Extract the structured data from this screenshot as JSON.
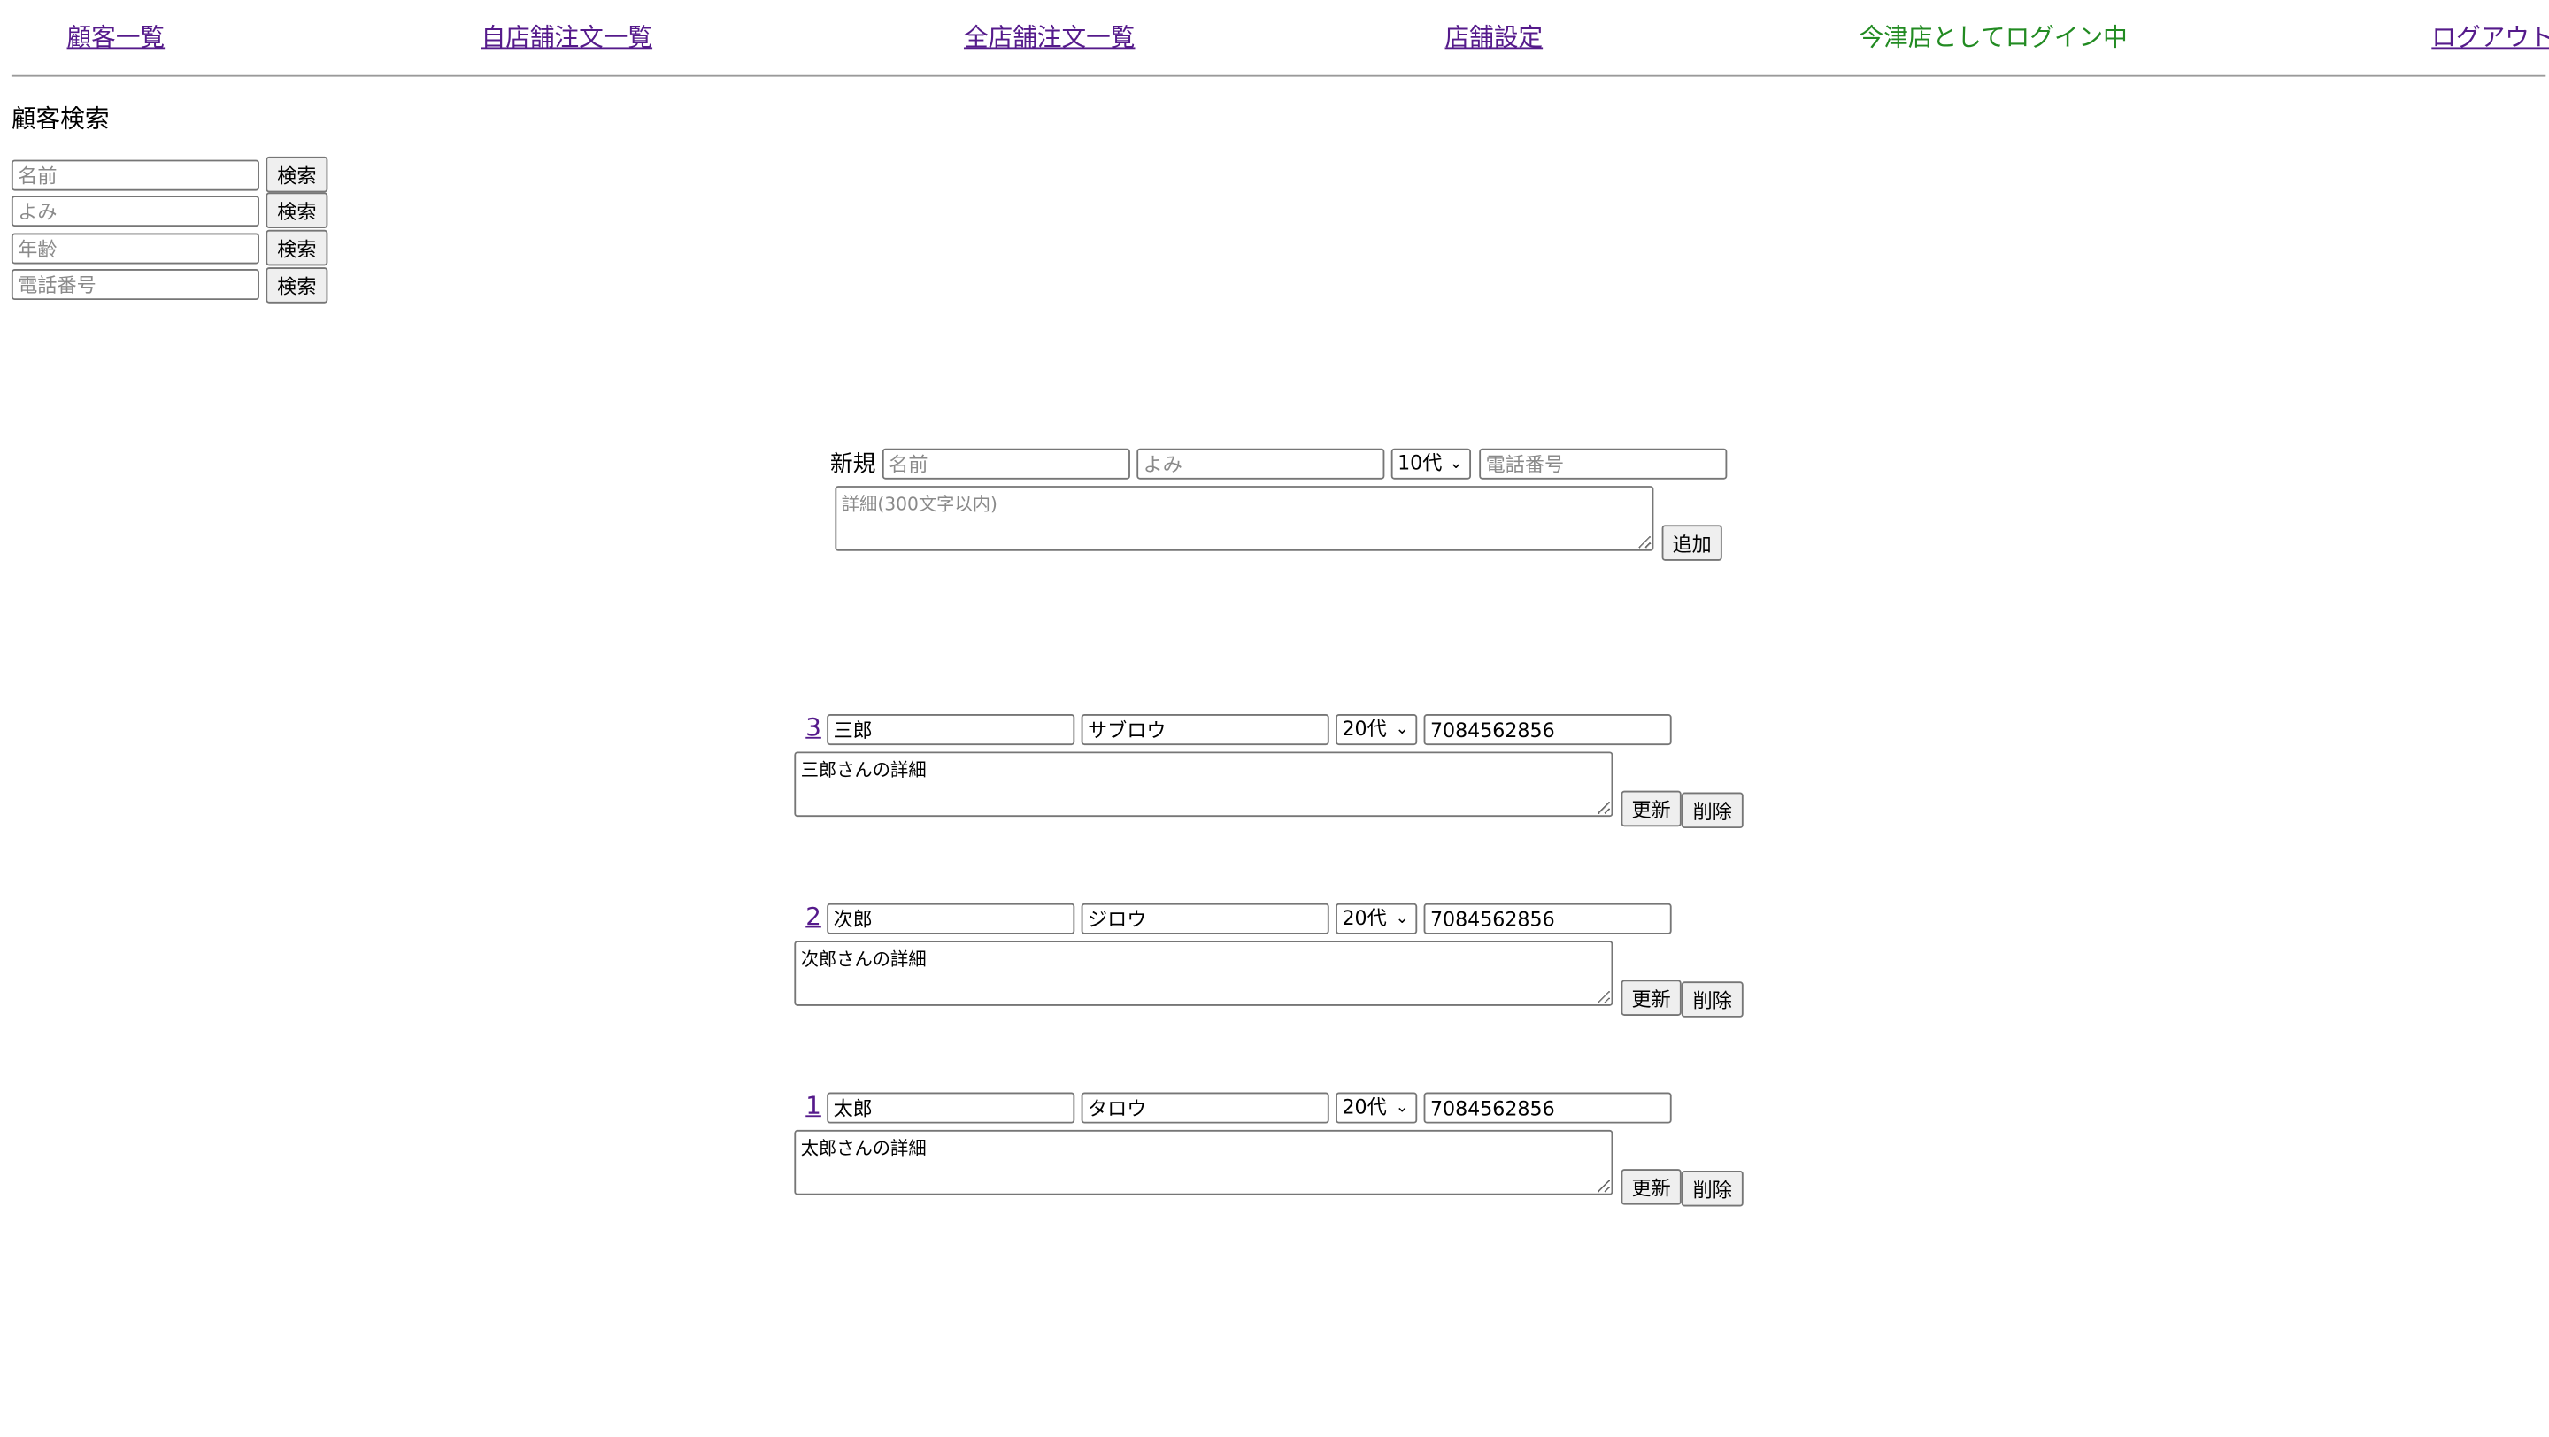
{
  "nav": {
    "customers": "顧客一覧",
    "own_orders": "自店舗注文一覧",
    "all_orders": "全店舗注文一覧",
    "store_settings": "店舗設定",
    "login_status": "今津店としてログイン中",
    "logout": "ログアウト"
  },
  "search": {
    "title": "顧客検索",
    "fields": [
      {
        "placeholder": "名前",
        "button": "検索"
      },
      {
        "placeholder": "よみ",
        "button": "検索"
      },
      {
        "placeholder": "年齢",
        "button": "検索"
      },
      {
        "placeholder": "電話番号",
        "button": "検索"
      }
    ]
  },
  "new_customer": {
    "label": "新規",
    "name_placeholder": "名前",
    "yomi_placeholder": "よみ",
    "age_value": "10代",
    "phone_placeholder": "電話番号",
    "detail_placeholder": "詳細(300文字以内)",
    "add_button": "追加"
  },
  "customers": [
    {
      "id": "3",
      "name": "三郎",
      "yomi": "サブロウ",
      "age": "20代",
      "phone": "7084562856",
      "detail": "三郎さんの詳細",
      "update": "更新",
      "delete": "削除"
    },
    {
      "id": "2",
      "name": "次郎",
      "yomi": "ジロウ",
      "age": "20代",
      "phone": "7084562856",
      "detail": "次郎さんの詳細",
      "update": "更新",
      "delete": "削除"
    },
    {
      "id": "1",
      "name": "太郎",
      "yomi": "タロウ",
      "age": "20代",
      "phone": "7084562856",
      "detail": "太郎さんの詳細",
      "update": "更新",
      "delete": "削除"
    }
  ],
  "icons": {
    "dropdown": "chevron-down-icon"
  }
}
